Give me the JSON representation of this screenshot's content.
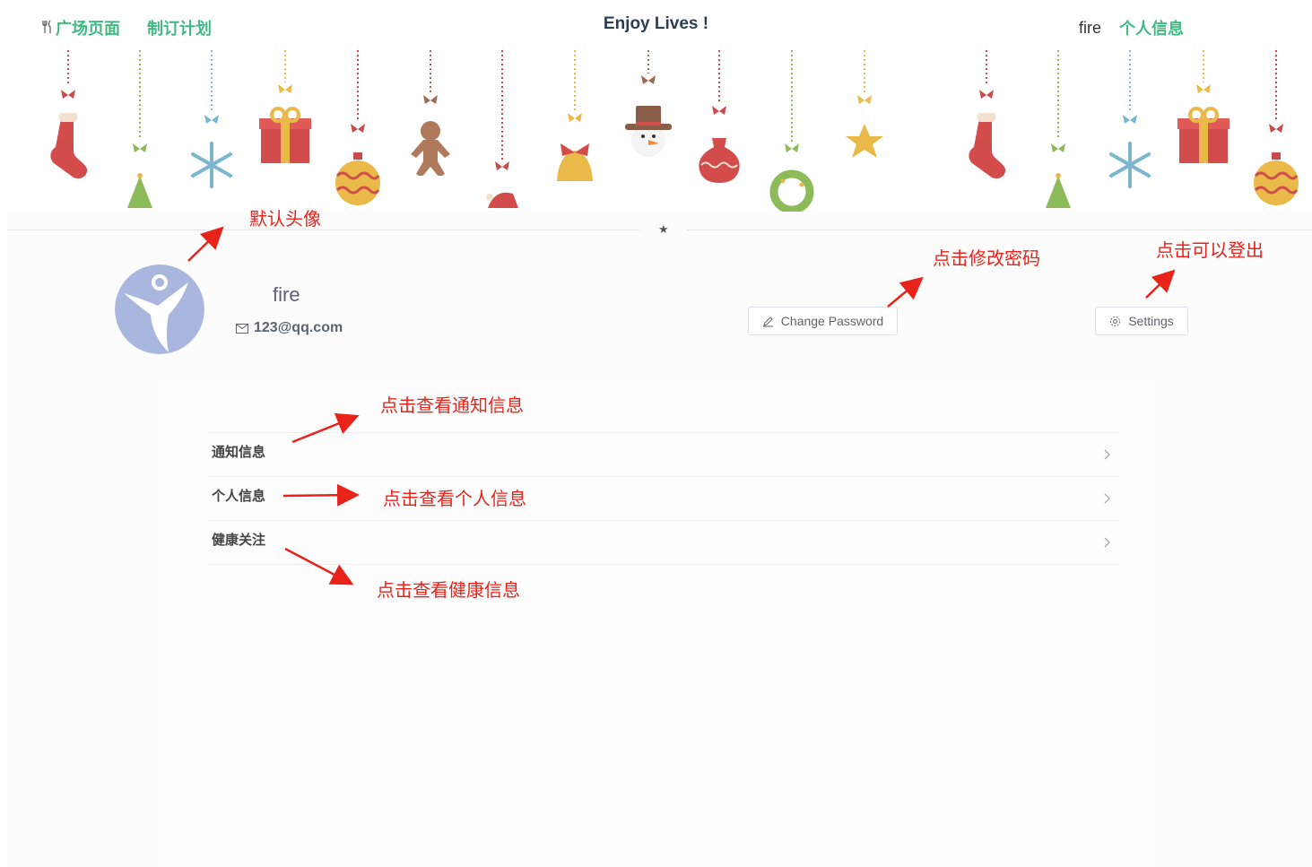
{
  "header": {
    "nav_left": [
      {
        "label": "广场页面",
        "icon": "fork-knife-icon"
      },
      {
        "label": "制订计划"
      }
    ],
    "title": "Enjoy Lives !",
    "username": "fire",
    "profile_link": "个人信息"
  },
  "profile": {
    "name": "fire",
    "email": "123@qq.com",
    "change_password_label": "Change Password",
    "settings_label": "Settings"
  },
  "menu": {
    "items": [
      {
        "label": "通知信息"
      },
      {
        "label": "个人信息"
      },
      {
        "label": "健康关注"
      }
    ]
  },
  "annotations": {
    "default_avatar": "默认头像",
    "change_password": "点击修改密码",
    "logout": "点击可以登出",
    "notifications": "点击查看通知信息",
    "personal_info": "点击查看个人信息",
    "health": "点击查看健康信息"
  },
  "colors": {
    "accent": "#42b983",
    "annotation": "#e8231a",
    "avatar_bg": "#a9b7df"
  }
}
